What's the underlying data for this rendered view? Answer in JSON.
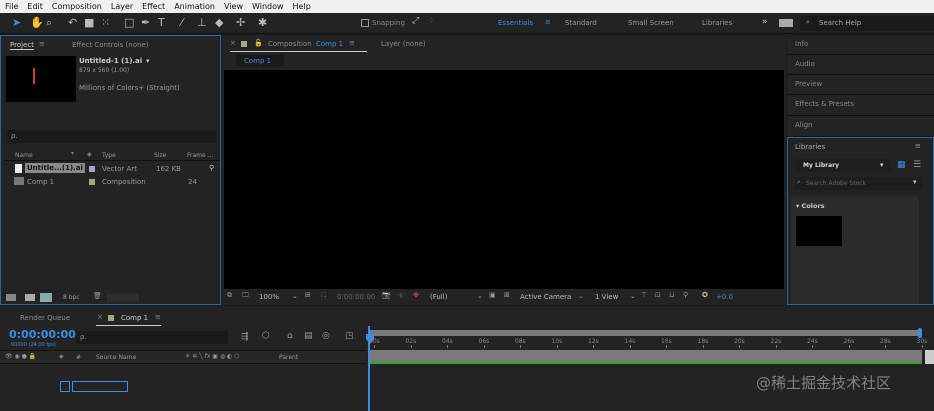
{
  "menu": [
    "File",
    "Edit",
    "Composition",
    "Layer",
    "Effect",
    "Animation",
    "View",
    "Window",
    "Help"
  ],
  "toolbar": {
    "snapping": "Snapping"
  },
  "workspaces": {
    "items": [
      "Essentials",
      "Standard",
      "Small Screen",
      "Libraries"
    ],
    "more": "»",
    "search_placeholder": "Search Help"
  },
  "project": {
    "tab": "Project",
    "tab2": "Effect Controls (none)",
    "file_name": "Untitled-1 (1).ai",
    "dims": "879 x 560 (1.00)",
    "colors": "Millions of Colors+ (Straight)",
    "search": "ρ.",
    "columns": [
      "Name",
      "Type",
      "Size",
      "Frame ..."
    ],
    "rows": [
      {
        "name": "Untitle...(1).ai",
        "type": "Vector Art",
        "size": "162 KB",
        "frame": "",
        "color": "#a9a3d6"
      },
      {
        "name": "Comp 1",
        "type": "Composition",
        "size": "",
        "frame": "24",
        "color": "#a7a77a"
      }
    ],
    "bpc": "8 bpc"
  },
  "comp": {
    "tab_prefix": "Composition",
    "tab_name": "Comp 1",
    "layer_tab": "Layer (none)",
    "subtab": "Comp 1",
    "zoom": "100%",
    "time": "0:00:00:00",
    "resolution": "(Full)",
    "camera": "Active Camera",
    "view": "1 View",
    "exposure": "+0.0"
  },
  "right": {
    "panels": [
      "Info",
      "Audio",
      "Preview",
      "Effects & Presets",
      "Align"
    ],
    "libraries": "Libraries",
    "library": "My Library",
    "stock_search": "Search Adobe Stock",
    "colors": "Colors"
  },
  "timeline": {
    "render_queue": "Render Queue",
    "comp_tab": "Comp 1",
    "timecode": "0:00:00:00",
    "fps": "00000 (24.00 fps)",
    "search": "ρ.",
    "source_name": "Source Name",
    "parent": "Parent",
    "ruler": [
      "00s",
      "02s",
      "04s",
      "06s",
      "08s",
      "10s",
      "12s",
      "14s",
      "16s",
      "18s",
      "20s",
      "22s",
      "24s",
      "26s",
      "28s",
      "30s"
    ]
  },
  "watermark": "@稀土掘金技术社区"
}
